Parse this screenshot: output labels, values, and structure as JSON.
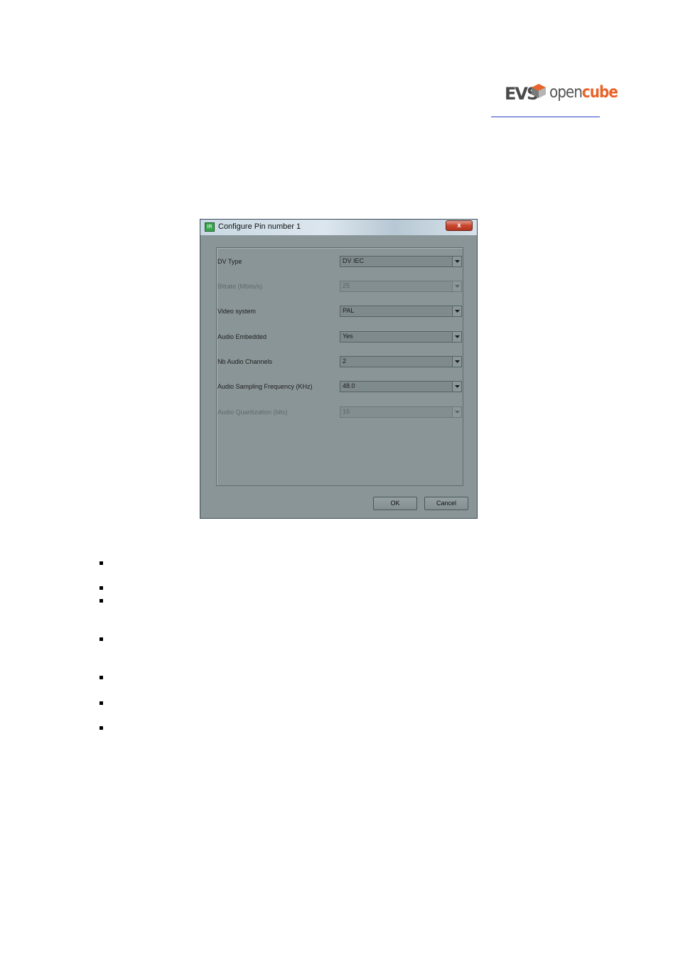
{
  "logo": {
    "evs": "EVS",
    "open": "open",
    "cube": "cube",
    "cube_color": "#e8642c"
  },
  "dialog": {
    "title": "Configure Pin number 1",
    "close_label": "x",
    "icon_label": "IR",
    "fields": [
      {
        "label": "DV Type",
        "value": "DV IEC",
        "enabled": true
      },
      {
        "label": "Bitrate (Mbits/s)",
        "value": "25",
        "enabled": false
      },
      {
        "label": "Video system",
        "value": "PAL",
        "enabled": true
      },
      {
        "label": "Audio Embedded",
        "value": "Yes",
        "enabled": true
      },
      {
        "label": "Nb Audio Channels",
        "value": "2",
        "enabled": true
      },
      {
        "label": "Audio Sampling Frequency (KHz)",
        "value": "48.0",
        "enabled": true
      },
      {
        "label": "Audio Quantization (bits)",
        "value": "16",
        "enabled": false
      }
    ],
    "ok_label": "OK",
    "cancel_label": "Cancel"
  }
}
